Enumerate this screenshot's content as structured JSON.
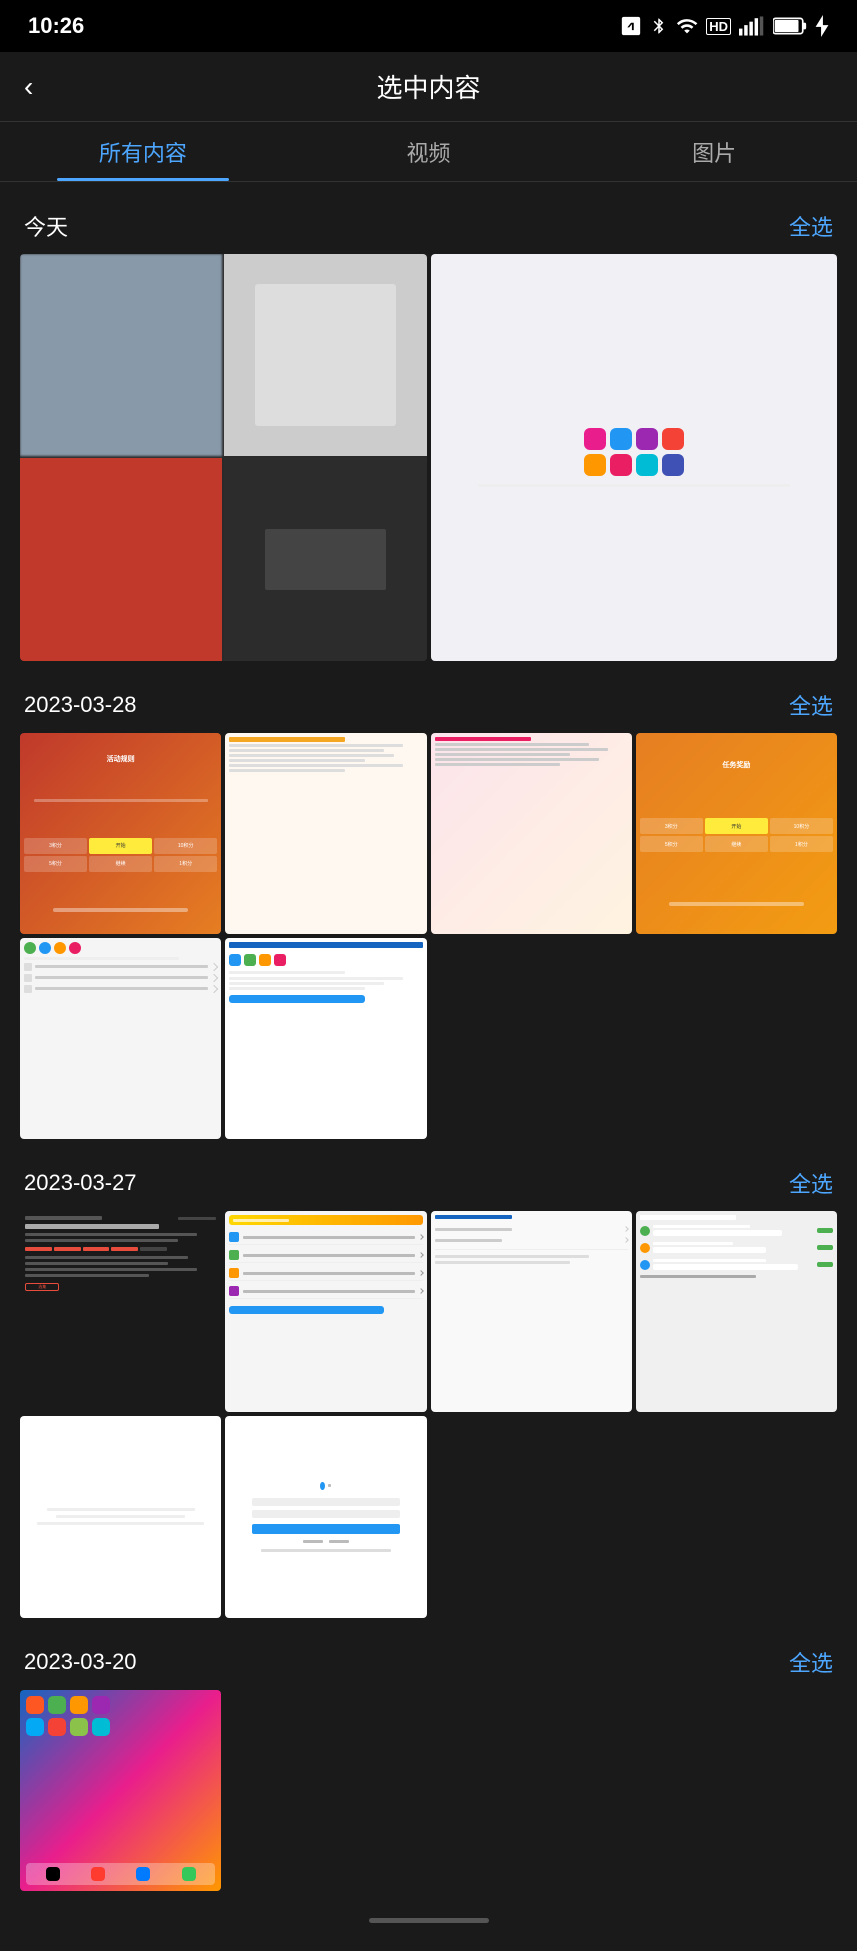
{
  "statusBar": {
    "time": "10:26",
    "icons": [
      "nfc",
      "bluetooth",
      "wifi",
      "hd",
      "signal",
      "battery"
    ]
  },
  "header": {
    "backLabel": "‹",
    "title": "选中内容"
  },
  "tabs": [
    {
      "id": "all",
      "label": "所有内容",
      "active": true
    },
    {
      "id": "video",
      "label": "视频",
      "active": false
    },
    {
      "id": "image",
      "label": "图片",
      "active": false
    }
  ],
  "sections": [
    {
      "id": "today",
      "dateLabel": "今天",
      "selectAllLabel": "全选",
      "itemCount": 2
    },
    {
      "id": "2023-03-28",
      "dateLabel": "2023-03-28",
      "selectAllLabel": "全选",
      "itemCount": 6
    },
    {
      "id": "2023-03-27",
      "dateLabel": "2023-03-27",
      "selectAllLabel": "全选",
      "itemCount": 6
    },
    {
      "id": "2023-03-20",
      "dateLabel": "2023-03-20",
      "selectAllLabel": "全选",
      "itemCount": 1
    }
  ],
  "colors": {
    "accent": "#4da6ff",
    "background": "#1a1a1a",
    "surface": "#2a2a2a",
    "text": "#ffffff",
    "textMuted": "#aaaaaa"
  }
}
